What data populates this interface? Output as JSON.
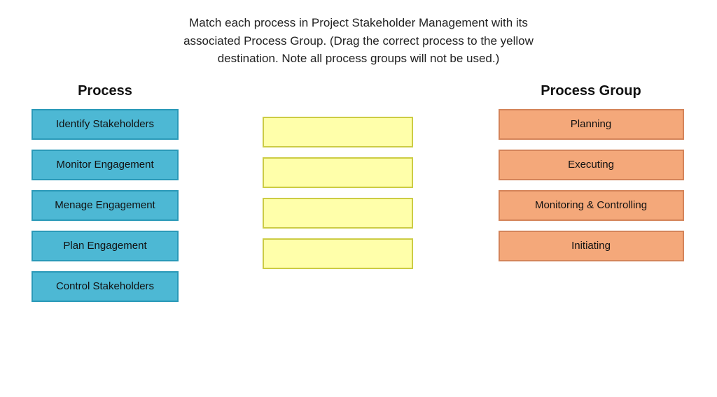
{
  "instructions": {
    "line1": "Match each process in Project Stakeholder Management with its",
    "line2": "associated Process Group. (Drag the correct process to the yellow",
    "line3": "destination.  Note all process groups will not be used.)"
  },
  "process_column": {
    "header": "Process",
    "items": [
      {
        "id": "p1",
        "label": "Identify Stakeholders"
      },
      {
        "id": "p2",
        "label": "Monitor Engagement"
      },
      {
        "id": "p3",
        "label": "Menage Engagement"
      },
      {
        "id": "p4",
        "label": "Plan Engagement"
      },
      {
        "id": "p5",
        "label": "Control Stakeholders"
      }
    ]
  },
  "drop_zones": [
    {
      "id": "d1"
    },
    {
      "id": "d2"
    },
    {
      "id": "d3"
    },
    {
      "id": "d4"
    }
  ],
  "group_column": {
    "header": "Process Group",
    "items": [
      {
        "id": "g1",
        "label": "Planning"
      },
      {
        "id": "g2",
        "label": "Executing"
      },
      {
        "id": "g3",
        "label": "Monitoring & Controlling"
      },
      {
        "id": "g4",
        "label": "Initiating"
      }
    ]
  }
}
